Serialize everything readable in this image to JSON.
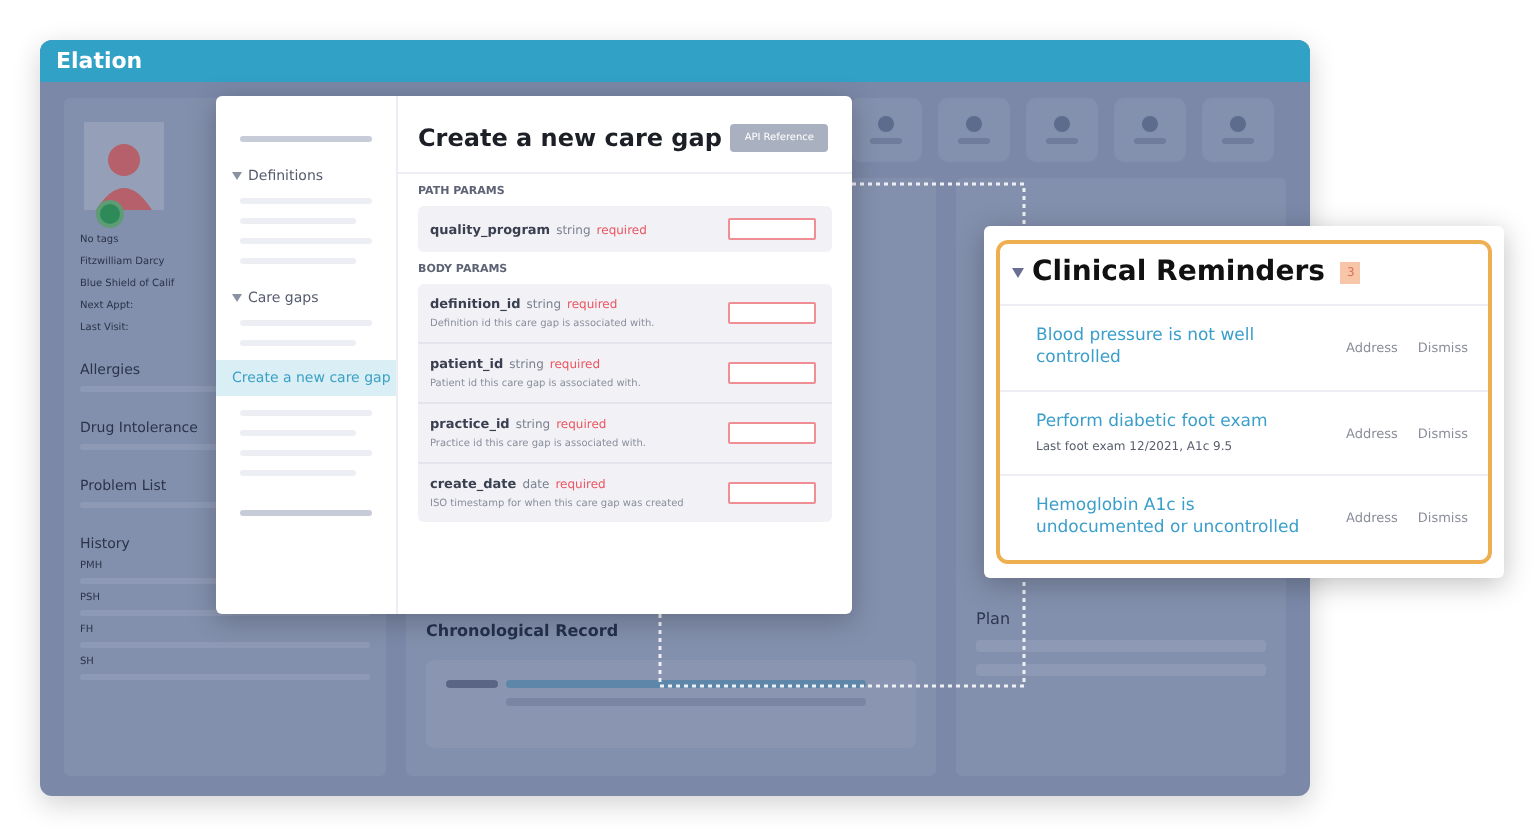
{
  "app": {
    "logo": "Elation"
  },
  "patient": {
    "tags": "No tags",
    "name": "Fitzwilliam Darcy",
    "insurance": "Blue Shield of Calif",
    "next_appt": "Next Appt:",
    "last_visit": "Last Visit:"
  },
  "sections": [
    "Allergies",
    "Drug Intolerance",
    "Problem List"
  ],
  "history": {
    "title": "History",
    "items": [
      "PMH",
      "PSH",
      "FH",
      "SH"
    ]
  },
  "center": {
    "heading": "Chronological Record"
  },
  "plan": {
    "heading": "Plan"
  },
  "modal": {
    "nav": [
      {
        "label": "Definitions"
      },
      {
        "label": "Care gaps",
        "children": [
          {
            "label": "Create a new care gap",
            "selected": true
          }
        ]
      }
    ],
    "title": "Create a new care gap",
    "button": "API Reference",
    "groups": [
      {
        "label": "PATH PARAMS",
        "params": [
          {
            "name": "quality_program",
            "type": "string",
            "required": "required"
          }
        ]
      },
      {
        "label": "BODY PARAMS",
        "params": [
          {
            "name": "definition_id",
            "type": "string",
            "required": "required",
            "description": "Definition id this care gap is associated with."
          },
          {
            "name": "patient_id",
            "type": "string",
            "required": "required",
            "description": "Patient id this care gap is associated with."
          },
          {
            "name": "practice_id",
            "type": "string",
            "required": "required",
            "description": "Practice id this care gap is associated with."
          },
          {
            "name": "create_date",
            "type": "date",
            "required": "required",
            "description": "ISO timestamp for when this care gap was created"
          }
        ]
      }
    ]
  },
  "reminders": {
    "title": "Clinical Reminders",
    "count": "3",
    "items": [
      {
        "title": "Blood pressure is not well controlled",
        "actions": [
          "Address",
          "Dismiss"
        ]
      },
      {
        "title": "Perform diabetic foot exam",
        "detail": "Last foot exam 12/2021, A1c 9.5",
        "actions": [
          "Address",
          "Dismiss"
        ]
      },
      {
        "title": "Hemoglobin A1c is undocumented or uncontrolled",
        "actions": [
          "Address",
          "Dismiss"
        ]
      }
    ]
  }
}
